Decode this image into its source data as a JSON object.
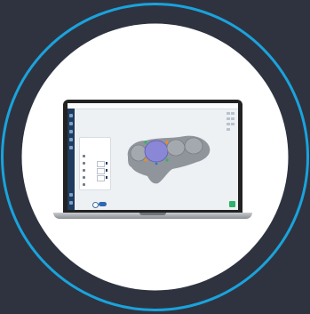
{
  "colors": {
    "background": "#2f3340",
    "ring": "#1aa3dc",
    "circle_fill": "#ffffff",
    "nav": "#1f3b5e",
    "accent_blue": "#2f67b1",
    "scan_gray": "#8f959b",
    "tooth_purple": "#8a87d6",
    "go_green": "#2fb36a"
  },
  "app": {
    "tabs": [
      "",
      ""
    ],
    "panel_title": "",
    "panel_tabs": [
      "",
      ""
    ],
    "panel_rows": [
      "",
      "",
      "",
      "",
      ""
    ]
  },
  "icons": {
    "nav": [
      "menu-icon",
      "upload-icon",
      "cut-icon",
      "layers-icon",
      "tooth-icon",
      "settings-icon",
      "help-icon"
    ],
    "toolstrip": [
      "view-icon",
      "rotate-icon",
      "zoom-icon",
      "measure-icon",
      "color-icon",
      "grid-icon",
      "reset-icon"
    ],
    "bottom": [
      "undo-icon",
      "confirm-icon"
    ],
    "next": "next-arrow-icon"
  }
}
